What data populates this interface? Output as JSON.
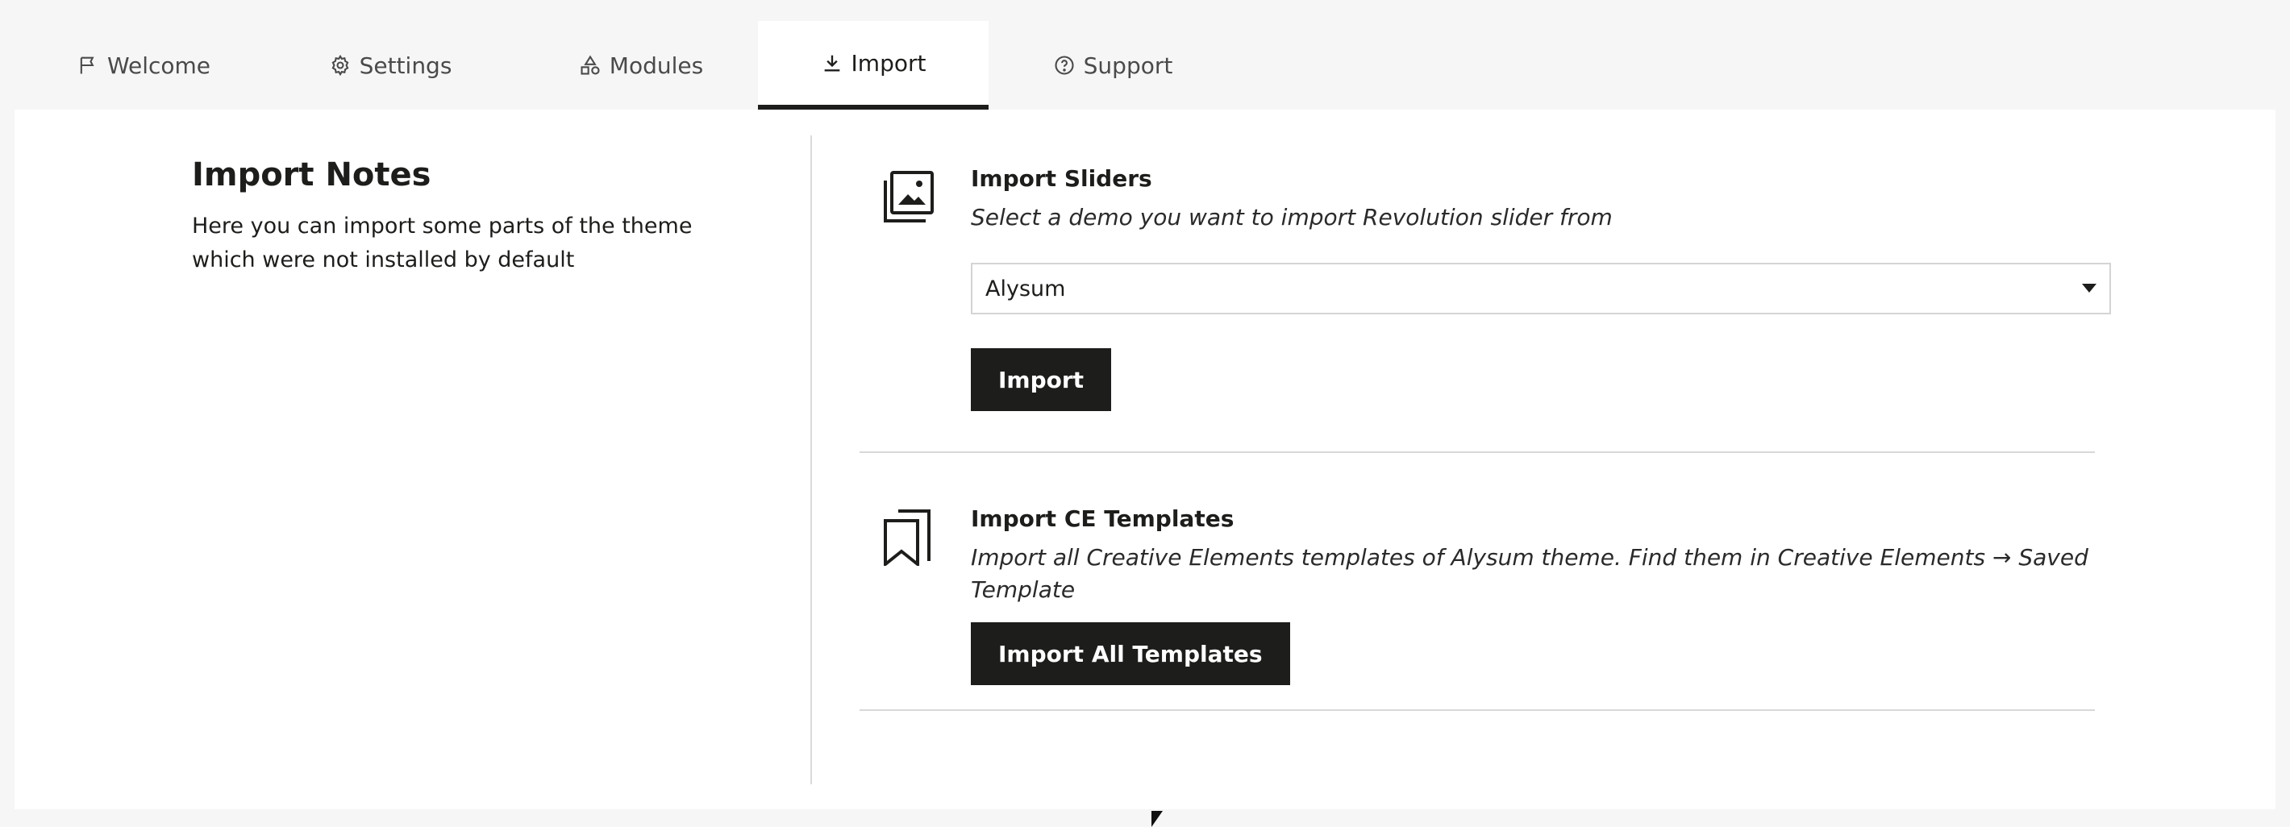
{
  "tabs": [
    {
      "label": "Welcome",
      "icon": "flag-icon"
    },
    {
      "label": "Settings",
      "icon": "gear-icon"
    },
    {
      "label": "Modules",
      "icon": "shapes-icon"
    },
    {
      "label": "Import",
      "icon": "download-icon",
      "active": true
    },
    {
      "label": "Support",
      "icon": "help-circle-icon"
    }
  ],
  "notes": {
    "title": "Import Notes",
    "text": "Here you can import some parts of the theme which were not installed by default"
  },
  "sliders": {
    "icon": "images-stack-icon",
    "title": "Import Sliders",
    "description": "Select a demo you want to import Revolution slider from",
    "selected_demo": "Alysum",
    "button_label": "Import"
  },
  "templates": {
    "icon": "bookmarks-icon",
    "title": "Import CE Templates",
    "description": "Import all Creative Elements templates of Alysum theme. Find them in Creative Elements → Saved Template",
    "button_label": "Import All Templates"
  },
  "colors": {
    "accent": "#1d1d1b",
    "background": "#f6f6f6",
    "panel": "#ffffff"
  }
}
